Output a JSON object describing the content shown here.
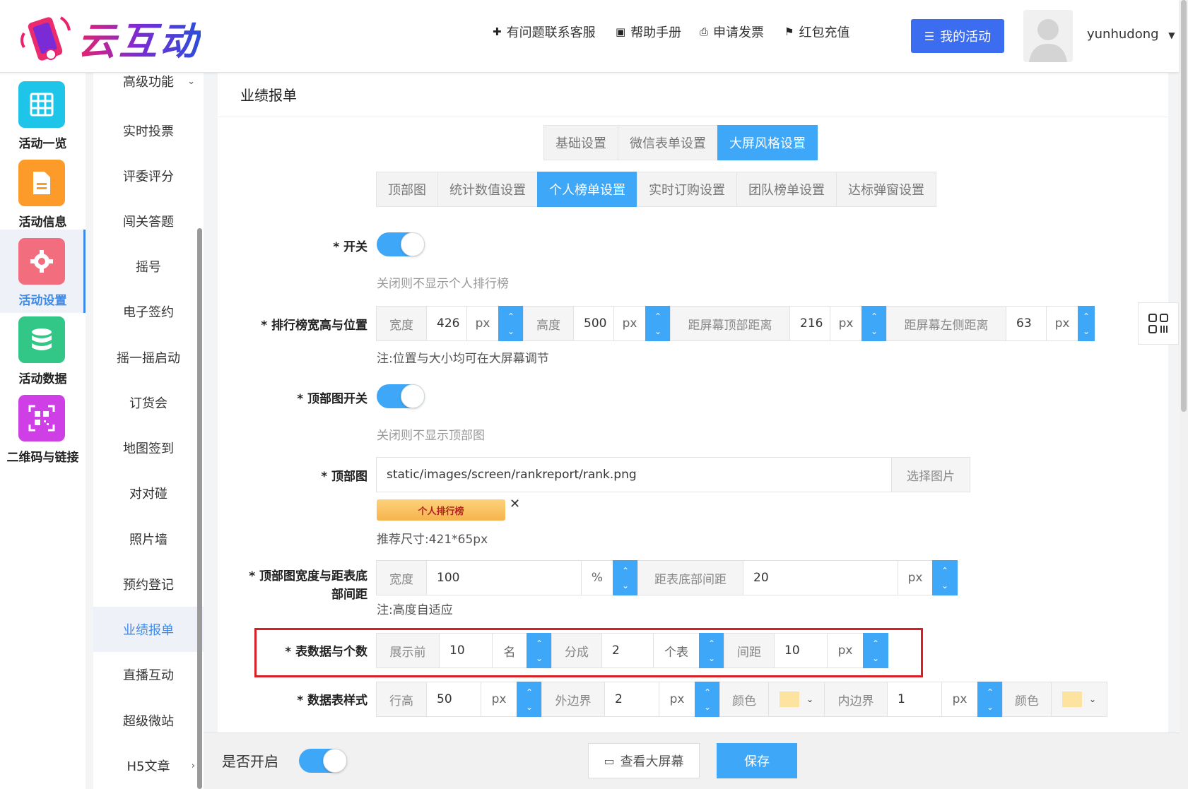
{
  "app": {
    "logo_text": "云互动"
  },
  "header": {
    "nav": [
      {
        "label": "有问题联系客服",
        "icon": "user-plus-icon"
      },
      {
        "label": "帮助手册",
        "icon": "book-icon"
      },
      {
        "label": "申请发票",
        "icon": "printer-icon"
      },
      {
        "label": "红包充值",
        "icon": "shield-check-icon"
      }
    ],
    "my_activity": "我的活动",
    "username": "yunhudong"
  },
  "iconbar": [
    {
      "label": "活动一览",
      "color": "#1ec5e8",
      "icon": "grid-icon"
    },
    {
      "label": "活动信息",
      "color": "#fd9b2a",
      "icon": "document-icon"
    },
    {
      "label": "活动设置",
      "color": "#f26d7d",
      "icon": "gear-icon"
    },
    {
      "label": "活动数据",
      "color": "#32c787",
      "icon": "database-icon"
    },
    {
      "label": "二维码与链接",
      "color": "#cf3fe6",
      "icon": "qrcode-icon"
    }
  ],
  "menu2": [
    "高级功能",
    "实时投票",
    "评委评分",
    "闯关答题",
    "摇号",
    "电子签约",
    "摇一摇启动",
    "订货会",
    "地图签到",
    "对对碰",
    "照片墙",
    "预约登记",
    "业绩报单",
    "直播互动",
    "超级微站",
    "H5文章"
  ],
  "main": {
    "title": "业绩报单",
    "tabs1": [
      "基础设置",
      "微信表单设置",
      "大屏风格设置"
    ],
    "tabs2": [
      "顶部图",
      "统计数值设置",
      "个人榜单设置",
      "实时订购设置",
      "团队榜单设置",
      "达标弹窗设置"
    ],
    "switch_label": "* 开关",
    "switch_hint": "关闭则不显示个人排行榜",
    "pos_label": "* 排行榜宽高与位置",
    "pos": {
      "width_label": "宽度",
      "width_value": "426",
      "height_label": "高度",
      "height_value": "500",
      "top_label": "距屏幕顶部距离",
      "top_value": "216",
      "left_label": "距屏幕左侧距离",
      "left_value": "63",
      "unit": "px"
    },
    "pos_note": "注:位置与大小均可在大屏幕调节",
    "topimg_switch_label": "* 顶部图开关",
    "topimg_switch_hint": "关闭则不显示顶部图",
    "topimg_label": "* 顶部图",
    "topimg_path": "static/images/screen/rankreport/rank.png",
    "topimg_select": "选择图片",
    "topimg_preview_text": "个人排行榜",
    "topimg_size_hint": "推荐尺寸:421*65px",
    "topwidth_label_1": "* 顶部图宽度与距表底",
    "topwidth_label_2": "部间距",
    "topwidth": {
      "width_label": "宽度",
      "width_value": "100",
      "pct": "%",
      "gap_label": "距表底部间距",
      "gap_value": "20",
      "unit": "px"
    },
    "topwidth_note": "注:高度自适应",
    "tabledata_label": "* 表数据与个数",
    "tabledata": {
      "show_label": "展示前",
      "show_value": "10",
      "show_unit": "名",
      "split_label": "分成",
      "split_value": "2",
      "split_unit": "个表",
      "gap_label": "间距",
      "gap_value": "10",
      "unit": "px"
    },
    "tablestyle_label": "* 数据表样式",
    "tablestyle": {
      "lh_label": "行高",
      "lh_value": "50",
      "margin_label": "外边界",
      "margin_value": "2",
      "color_label": "颜色",
      "padding_label": "内边界",
      "padding_value": "1",
      "color2_label": "颜色",
      "unit": "px",
      "swatch_color": "#fde3a0"
    }
  },
  "footer": {
    "enable_label": "是否开启",
    "view_button": "查看大屏幕",
    "save_button": "保存"
  }
}
